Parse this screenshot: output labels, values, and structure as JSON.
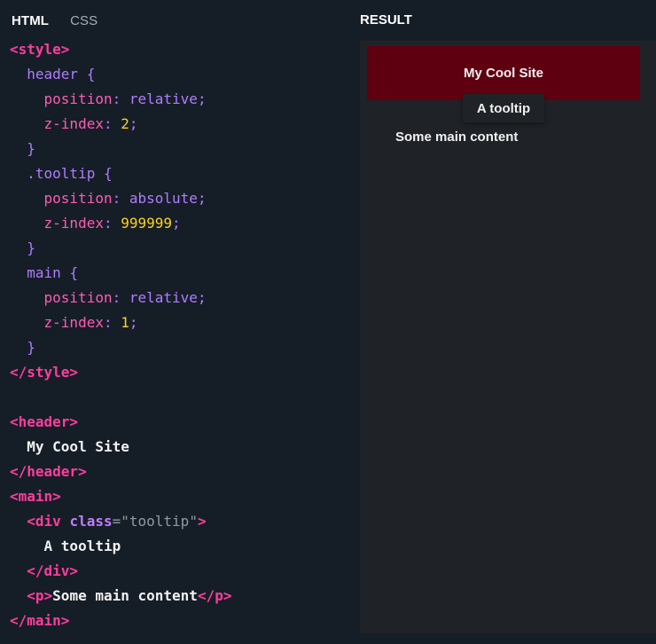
{
  "tabs": {
    "html": "HTML",
    "css": "CSS"
  },
  "result_label": "RESULT",
  "code": {
    "l1": "<style>",
    "l2_sel": "header",
    "l2_brace": "{",
    "l3_prop": "position",
    "l3_val": "relative",
    "l4_prop": "z-index",
    "l4_val": "2",
    "l5": "}",
    "l6_sel": ".tooltip",
    "l6_brace": "{",
    "l7_prop": "position",
    "l7_val": "absolute",
    "l8_prop": "z-index",
    "l8_val": "999999",
    "l9": "}",
    "l10_sel": "main",
    "l10_brace": "{",
    "l11_prop": "position",
    "l11_val": "relative",
    "l12_prop": "z-index",
    "l12_val": "1",
    "l13": "}",
    "l14": "</style>",
    "l16": "<header>",
    "l17": "My Cool Site",
    "l18": "</header>",
    "l19": "<main>",
    "l20_open": "<div",
    "l20_attr": "class",
    "l20_eq": "=",
    "l20_str": "\"tooltip\"",
    "l20_close": ">",
    "l21": "A tooltip",
    "l22": "</div>",
    "l23_open": "<p>",
    "l23_text": "Some main content",
    "l23_close": "</p>",
    "l24": "</main>"
  },
  "result": {
    "header": "My Cool Site",
    "tooltip": "A tooltip",
    "main": "Some main content"
  }
}
